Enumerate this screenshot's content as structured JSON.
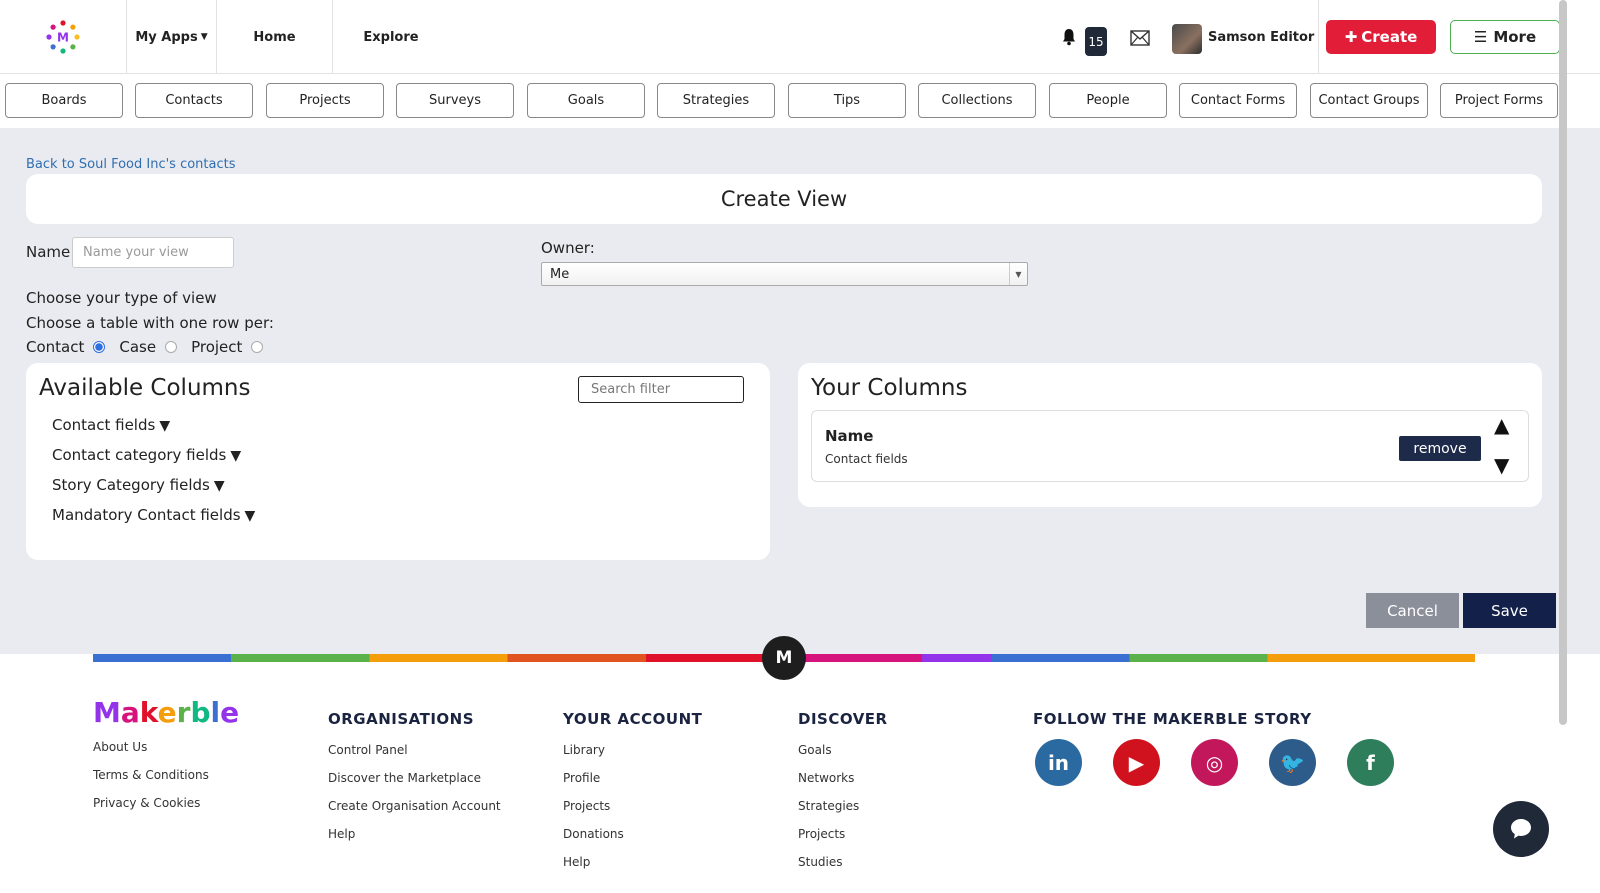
{
  "header": {
    "my_apps": "My Apps",
    "home": "Home",
    "explore": "Explore",
    "notification_count": "15",
    "user_name": "Samson Editor",
    "create_label": "Create",
    "more_label": "More"
  },
  "subnav": [
    "Boards",
    "Contacts",
    "Projects",
    "Surveys",
    "Goals",
    "Strategies",
    "Tips",
    "Collections",
    "People",
    "Contact Forms",
    "Contact Groups",
    "Project Forms"
  ],
  "page": {
    "back_link": "Back to Soul Food Inc's contacts",
    "title": "Create View",
    "name_label": "Name",
    "name_placeholder": "Name your view",
    "owner_label": "Owner:",
    "owner_value": "Me",
    "type_label": "Choose your type of view",
    "table_label": "Choose a table with one row per:",
    "row_options": [
      {
        "label": "Contact",
        "checked": true
      },
      {
        "label": "Case",
        "checked": false
      },
      {
        "label": "Project",
        "checked": false
      }
    ]
  },
  "available_columns": {
    "title": "Available Columns",
    "search_placeholder": "Search filter",
    "groups": [
      "Contact fields",
      "Contact category fields",
      "Story Category fields",
      "Mandatory Contact fields"
    ]
  },
  "your_columns": {
    "title": "Your Columns",
    "items": [
      {
        "name": "Name",
        "source": "Contact fields",
        "remove_label": "remove"
      }
    ]
  },
  "actions": {
    "cancel": "Cancel",
    "save": "Save"
  },
  "footer": {
    "logo_letter": "M",
    "brand": "Makerble",
    "brand_links": [
      "About Us",
      "Terms & Conditions",
      "Privacy & Cookies"
    ],
    "columns": [
      {
        "title": "ORGANISATIONS",
        "links": [
          "Control Panel",
          "Discover the Marketplace",
          "Create Organisation Account",
          "Help"
        ]
      },
      {
        "title": "YOUR ACCOUNT",
        "links": [
          "Library",
          "Profile",
          "Projects",
          "Donations",
          "Help"
        ]
      },
      {
        "title": "DISCOVER",
        "links": [
          "Goals",
          "Networks",
          "Strategies",
          "Projects",
          "Studies"
        ]
      }
    ],
    "follow_title": "FOLLOW THE MAKERBLE STORY",
    "socials": [
      {
        "icon": "linkedin-icon",
        "glyph": "in",
        "color": "#2b6aa0"
      },
      {
        "icon": "youtube-icon",
        "glyph": "▶",
        "color": "#d0121f"
      },
      {
        "icon": "instagram-icon",
        "glyph": "◎",
        "color": "#c2185b"
      },
      {
        "icon": "twitter-icon",
        "glyph": "🐦",
        "color": "#2d5b8a"
      },
      {
        "icon": "facebook-icon",
        "glyph": "f",
        "color": "#2e7d5b"
      }
    ]
  },
  "colors": {
    "accent_create": "#e11d38",
    "primary_navy": "#13204a",
    "page_bg": "#e9ebf0"
  }
}
